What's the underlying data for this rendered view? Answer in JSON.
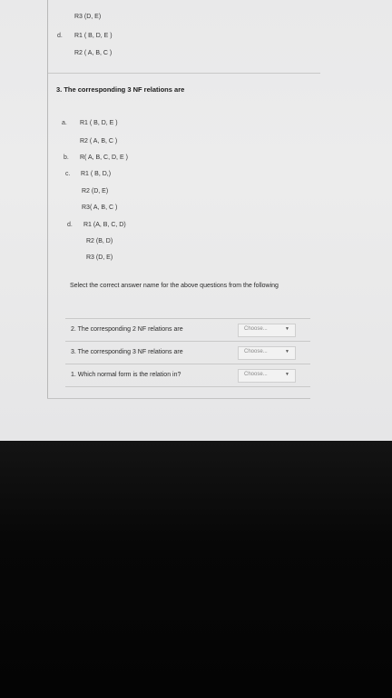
{
  "top_options": [
    {
      "letter": "",
      "line": "R3 (D, E)"
    },
    {
      "letter": "d.",
      "line": "R1 ( B, D, E )"
    },
    {
      "letter": "",
      "line": "R2 ( A, B, C )"
    }
  ],
  "question3": {
    "heading": "3. The corresponding 3 NF relations are",
    "options": [
      {
        "letter": "a.",
        "lines": [
          "R1 ( B, D, E )",
          "R2 ( A, B, C )"
        ]
      },
      {
        "letter": "b.",
        "lines": [
          "R( A, B, C, D, E )"
        ]
      },
      {
        "letter": "c.",
        "lines": [
          "R1 ( B, D,)",
          "R2 (D, E)",
          "R3( A, B, C )"
        ]
      },
      {
        "letter": "d.",
        "lines": [
          "R1 (A, B, C, D)",
          "R2 (B, D)",
          "R3 (D, E)"
        ]
      }
    ]
  },
  "instruction": "Select the correct answer name for the above questions from the following",
  "matching": [
    {
      "question": "2. The corresponding 2 NF relations are",
      "select_label": "Choose...",
      "arrow": "▼"
    },
    {
      "question": "3. The corresponding 3 NF relations are",
      "select_label": "Choose...",
      "arrow": "▼"
    },
    {
      "question": "1. Which normal form is the relation in?",
      "select_label": "Choose...",
      "arrow": "▼"
    }
  ]
}
